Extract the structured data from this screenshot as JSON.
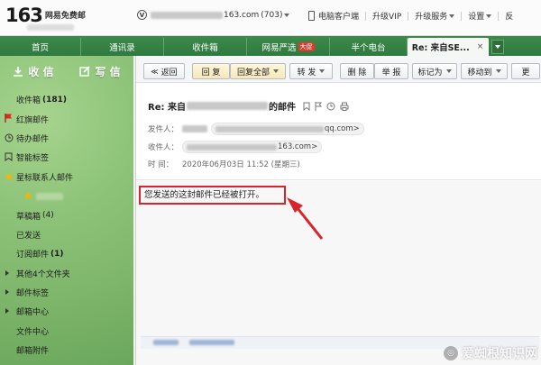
{
  "header": {
    "logo_number": "163",
    "logo_text": "网易免费邮",
    "user_badge": "V",
    "user_domain": "163.com",
    "unread_count": "(703)",
    "links": [
      "电脑客户端",
      "升级VIP",
      "升级服务",
      "设置",
      "反"
    ]
  },
  "tabs": [
    {
      "label": "首页"
    },
    {
      "label": "通讯录"
    },
    {
      "label": "收件箱"
    },
    {
      "label": "网易严选",
      "badge": "大促"
    },
    {
      "label": "半个电台"
    },
    {
      "label": "Re: 来自SE...",
      "close": "×"
    }
  ],
  "sidebar": {
    "compose_inbox": "收 信",
    "compose_write": "写 信",
    "folders": [
      {
        "label": "收件箱",
        "count": "(181)",
        "bold": false
      },
      {
        "label": "红旗邮件",
        "icon": "flag-icon"
      },
      {
        "label": "待办邮件",
        "icon": "clock-icon"
      },
      {
        "label": "智能标签",
        "icon": "tag-icon"
      },
      {
        "label": "星标联系人邮件",
        "icon": "star-icon"
      },
      {
        "label": "",
        "icon": "star-icon",
        "sub": true
      },
      {
        "label": "草稿箱",
        "count": "(4)"
      },
      {
        "label": "已发送"
      },
      {
        "label": "订阅邮件",
        "count": "(1)",
        "count_bold": true
      },
      {
        "label": "其他4个文件夹",
        "arrow": true
      },
      {
        "label": "邮件标签",
        "arrow": true
      },
      {
        "label": "邮箱中心",
        "arrow": true
      },
      {
        "label": "文件中心"
      },
      {
        "label": "邮箱附件"
      }
    ]
  },
  "toolbar": {
    "back": "返回",
    "reply": "回 复",
    "reply_all": "回复全部",
    "forward": "转 发",
    "delete": "删 除",
    "report": "举 报",
    "mark_as": "标记为",
    "move_to": "移动到",
    "more": "更"
  },
  "mail": {
    "subject_prefix": "Re: 来自",
    "subject_suffix": "的邮件",
    "from_label": "发件人：",
    "from_domain": "qq.com>",
    "to_label": "收件人：",
    "to_domain": "163.com>",
    "time_label": "时  间：",
    "time_value": "2020年06月03日 11:52 (星期三)",
    "body_text": "您发送的这封邮件已经被打开。"
  },
  "watermark": "爱蜘根知识网",
  "colors": {
    "tabbar": "#2f7a3e",
    "sidebar": "#8ec47a",
    "highlight": "#d8242b"
  }
}
